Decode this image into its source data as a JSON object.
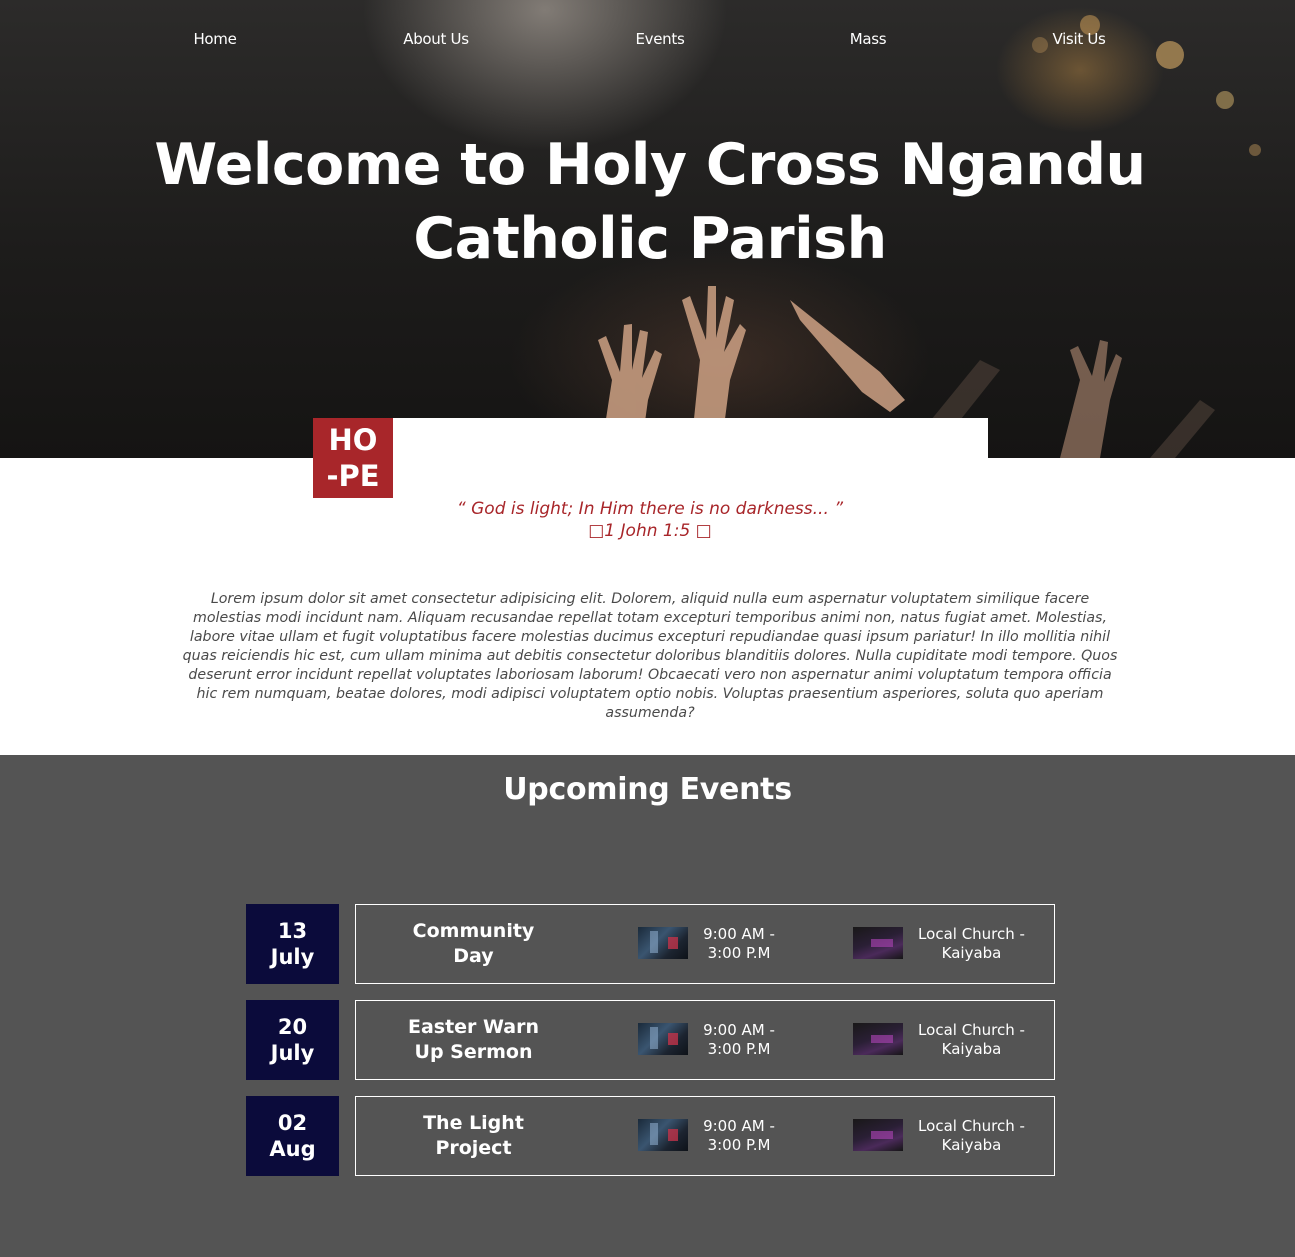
{
  "nav": {
    "items": [
      {
        "label": "Home"
      },
      {
        "label": "About Us"
      },
      {
        "label": "Events"
      },
      {
        "label": "Mass"
      },
      {
        "label": "Visit Us"
      }
    ]
  },
  "hero": {
    "title_line1": "Welcome to Holy Cross Ngandu",
    "title_line2": "Catholic Parish"
  },
  "hope": {
    "badge_line1": "HO",
    "badge_line2": "-PE",
    "quote": "“ God is light; In Him there is no darkness... ”",
    "reference": "□1 John 1:5 □",
    "body": "Lorem ipsum dolor sit amet consectetur adipisicing elit. Dolorem, aliquid nulla eum aspernatur voluptatem similique facere molestias modi incidunt nam. Aliquam recusandae repellat totam excepturi temporibus animi non, natus fugiat amet. Molestias, labore vitae ullam et fugit voluptatibus facere molestias ducimus excepturi repudiandae quasi ipsum pariatur! In illo mollitia nihil quas reiciendis hic est, cum ullam minima aut debitis consectetur doloribus blanditiis dolores. Nulla cupiditate modi tempore. Quos deserunt error incidunt repellat voluptates laboriosam laborum! Obcaecati vero non aspernatur animi voluptatum tempora officia hic rem numquam, beatae dolores, modi adipisci voluptatem optio nobis. Voluptas praesentium asperiores, soluta quo aperiam assumenda?"
  },
  "events": {
    "title": "Upcoming Events",
    "items": [
      {
        "day": "13",
        "month": "July",
        "name_line1": "Community",
        "name_line2": "Day",
        "time_line1": "9:00 AM -",
        "time_line2": "3:00 P.M",
        "loc_line1": "Local Church -",
        "loc_line2": "Kaiyaba"
      },
      {
        "day": "20",
        "month": "July",
        "name_line1": "Easter Warn",
        "name_line2": "Up Sermon",
        "time_line1": "9:00 AM -",
        "time_line2": "3:00 P.M",
        "loc_line1": "Local Church -",
        "loc_line2": "Kaiyaba"
      },
      {
        "day": "02",
        "month": "Aug",
        "name_line1": "The Light",
        "name_line2": "Project",
        "time_line1": "9:00 AM -",
        "time_line2": "3:00 P.M",
        "loc_line1": "Local Church -",
        "loc_line2": "Kaiyaba"
      }
    ]
  },
  "colors": {
    "accent_red": "#a8262a",
    "date_navy": "#0b0b3b",
    "events_bg": "#545454"
  }
}
